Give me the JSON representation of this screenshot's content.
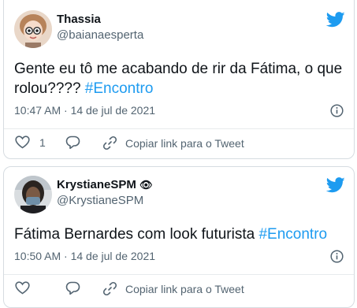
{
  "tweets": [
    {
      "display_name": "Thassia",
      "handle": "@baianaesperta",
      "text_part1": "Gente eu tô me acabando de rir da Fátima, o que",
      "text_part2": "rolou???? ",
      "hashtag": "#Encontro",
      "timestamp": "10:47 AM · 14 de jul de 2021",
      "like_count": "1",
      "copy_link_label": "Copiar link para o Tweet"
    },
    {
      "display_name": "KrystianeSPM",
      "name_emoji": "👁",
      "handle": "@KrystianeSPM",
      "text_part1": "Fátima Bernardes com look futurista ",
      "hashtag": "#Encontro",
      "timestamp": "10:50 AM · 14 de jul de 2021",
      "copy_link_label": "Copiar link para o Tweet"
    }
  ],
  "colors": {
    "twitter_blue": "#1d9bf0",
    "secondary_text": "#536471",
    "border": "#d6dce1"
  },
  "icons": [
    "twitter-bird-icon",
    "info-icon",
    "heart-icon",
    "reply-icon",
    "link-icon"
  ]
}
